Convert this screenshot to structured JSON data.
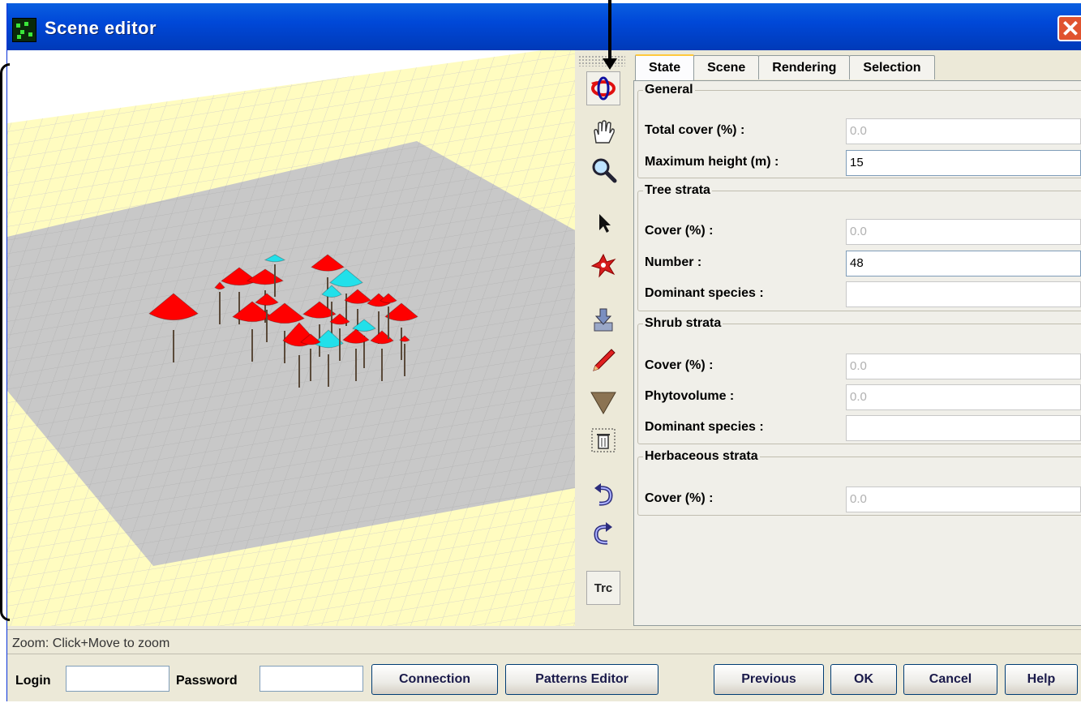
{
  "window": {
    "title": "Scene editor",
    "close_label": "✕"
  },
  "tabs": [
    "State",
    "Scene",
    "Rendering",
    "Selection"
  ],
  "general": {
    "legend": "General",
    "total_cover_label": "Total cover (%) :",
    "total_cover_value": "0.0",
    "max_height_label": "Maximum height (m) :",
    "max_height_value": "15"
  },
  "tree": {
    "legend": "Tree strata",
    "cover_label": "Cover (%) :",
    "cover_value": "0.0",
    "number_label": "Number :",
    "number_value": "48",
    "dominant_label": "Dominant species :",
    "dominant_value": ""
  },
  "shrub": {
    "legend": "Shrub strata",
    "cover_label": "Cover (%) :",
    "cover_value": "0.0",
    "phyto_label": "Phytovolume :",
    "phyto_value": "0.0",
    "dominant_label": "Dominant species :",
    "dominant_value": ""
  },
  "herb": {
    "legend": "Herbaceous strata",
    "cover_label": "Cover (%) :",
    "cover_value": "0.0"
  },
  "toolbar": {
    "icons": [
      "rotate-icon",
      "pan-hand-icon",
      "zoom-magnifier-icon",
      "select-arrow-icon",
      "random-scatter-icon",
      "import-icon",
      "pencil-icon",
      "cone-shape-icon",
      "trash-icon",
      "undo-icon",
      "redo-icon"
    ],
    "trc_label": "Trc"
  },
  "status": "Zoom: Click+Move to zoom",
  "bottom": {
    "login_label": "Login",
    "login_value": "",
    "password_label": "Password",
    "password_value": "",
    "connection_label": "Connection",
    "patterns_label": "Patterns Editor",
    "previous_label": "Previous",
    "ok_label": "OK",
    "cancel_label": "Cancel",
    "help_label": "Help"
  },
  "colors": {
    "tree_crown": "#ff0000",
    "tree_crown_alt": "#22e0ea",
    "ground": "#c8c8c8",
    "border_area": "#fffcc0",
    "titlebar": "#0050d8"
  }
}
